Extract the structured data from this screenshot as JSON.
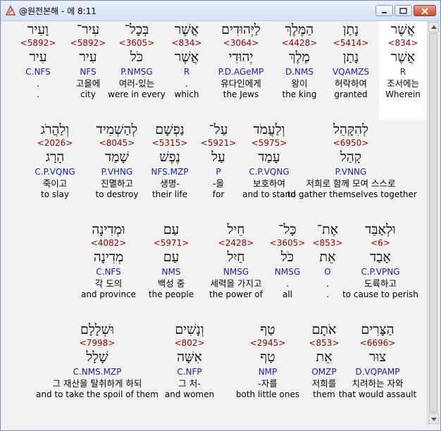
{
  "window": {
    "title": "@원전본해 - 에 8:11"
  },
  "rows": [
    {
      "words": [
        {
          "heb": "אֲשֶׁר",
          "strong": "<834>",
          "lemma": "אֲשֶׁר",
          "morph": "R",
          "kor": "조서에는",
          "eng": "Wherein"
        },
        {
          "heb": "נָתַן",
          "strong": "<5414>",
          "lemma": "נָתַן",
          "morph": "VQAMZS",
          "kor": "허락하여",
          "eng": "granted"
        },
        {
          "heb": "הַמֶּלֶךְ",
          "strong": "<4428>",
          "lemma": "מֶלֶךְ",
          "morph": "D.NMS",
          "kor": "왕이",
          "eng": "the king"
        },
        {
          "heb": "לַיְּהוּדִים",
          "strong": "<3064>",
          "lemma": "יְהוּדִי",
          "morph": "P.D.AGeMP",
          "kor": "유다인에게",
          "eng": "the Jews"
        },
        {
          "heb": "אֲשֶׁר",
          "strong": "<834>",
          "lemma": "אֲשֶׁר",
          "morph": "R",
          "kor": ".",
          "eng": "which"
        },
        {
          "heb": "בְּכָל־",
          "strong": "<3605>",
          "lemma": "כֹּל",
          "morph": "P.NMSG",
          "kor": "여러-있는",
          "eng": "were in every"
        },
        {
          "heb": "עִיר־",
          "strong": "<5892>",
          "lemma": "עִיר",
          "morph": "NFS",
          "kor": "고을에",
          "eng": "city"
        },
        {
          "heb": "וָעִיר",
          "strong": "<5892>",
          "lemma": "עִיר",
          "morph": "C.NFS",
          "kor": ".",
          "eng": "."
        }
      ]
    },
    {
      "words": [
        {
          "heb": "לְהִקָּהֵל",
          "strong": "<6950>",
          "lemma": "קָהַל",
          "morph": "P.VNNG",
          "kor": "저희로 함께 모여 스스로",
          "eng": "to gather themselves together"
        },
        {
          "heb": "וְלַעֲמֹד",
          "strong": "<5975>",
          "lemma": "עָמַד",
          "morph": "C.P.VQNG",
          "kor": "보호하여",
          "eng": "and to stand"
        },
        {
          "heb": "עַל־",
          "strong": "<5921>",
          "lemma": "עַל",
          "morph": "P",
          "kor": "-을",
          "eng": "for"
        },
        {
          "heb": "נַפְשָׁם",
          "strong": "<5315>",
          "lemma": "נֶפֶשׁ",
          "morph": "NFS.MZP",
          "kor": "생명-",
          "eng": "their life"
        },
        {
          "heb": "לְהַשְׁמִיד",
          "strong": "<8045>",
          "lemma": "שָׁמַד",
          "morph": "P.VHNG",
          "kor": "진멸하고",
          "eng": "to destroy"
        },
        {
          "heb": "וְלַהֲרֹג",
          "strong": "<2026>",
          "lemma": "הָרַג",
          "morph": "C.P.VQNG",
          "kor": "죽이고",
          "eng": "to slay"
        }
      ]
    },
    {
      "words": [
        {
          "heb": "וּלְאַבֵּד",
          "strong": "<6>",
          "lemma": "אָבַד",
          "morph": "C.P.VPNG",
          "kor": "도륙하고",
          "eng": "to cause to perish"
        },
        {
          "heb": "אֶת־",
          "strong": "<853>",
          "lemma": "אֵת",
          "morph": "O",
          "kor": ".",
          "eng": "."
        },
        {
          "heb": "כָּל־",
          "strong": "<3605>",
          "lemma": "כֹּל",
          "morph": "NMSG",
          "kor": ".",
          "eng": "all"
        },
        {
          "heb": "חֵיל",
          "strong": "<2428>",
          "lemma": "חַיִל",
          "morph": "NMSG",
          "kor": "세력을 가지고",
          "eng": "the power of"
        },
        {
          "heb": "עַם",
          "strong": "<5971>",
          "lemma": "עַם",
          "morph": "NMS",
          "kor": "백성 중",
          "eng": "the people"
        },
        {
          "heb": "וּמְדִינָה",
          "strong": "<4082>",
          "lemma": "מְדִינָה",
          "morph": "C.NFS",
          "kor": "각 도의",
          "eng": "and province"
        }
      ]
    },
    {
      "words": [
        {
          "heb": "הַצָּרִים",
          "strong": "<6696>",
          "lemma": "צוּר",
          "morph": "D.VQPAMP",
          "kor": "치려하는 자와",
          "eng": "that would assault"
        },
        {
          "heb": "אֹתָם",
          "strong": "<853>",
          "lemma": "אֵת",
          "morph": "OMZP",
          "kor": "저희를",
          "eng": "them"
        },
        {
          "heb": "טַף",
          "strong": "<2945>",
          "lemma": "טַף",
          "morph": "NMP",
          "kor": "-자를",
          "eng": "both little ones"
        },
        {
          "heb": "וְנָשִׁים",
          "strong": "<802>",
          "lemma": "אִשָּׁה",
          "morph": "C.NFP",
          "kor": "그 처-",
          "eng": "and women"
        },
        {
          "heb": "וּשְׁלָלָם",
          "strong": "<7998>",
          "lemma": "שָׁלָל",
          "morph": "C.NMS.MZP",
          "kor": "그 재산을 탈취하게 하되",
          "eng": "and to take the spoil of them"
        }
      ]
    }
  ]
}
